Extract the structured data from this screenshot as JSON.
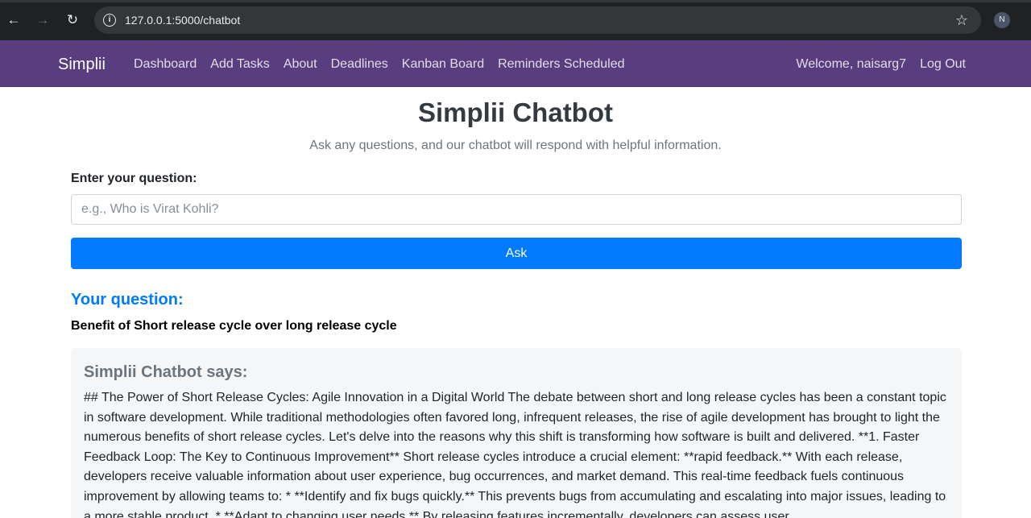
{
  "browser": {
    "url": "127.0.0.1:5000/chatbot",
    "profile_initial": "N",
    "icons": [
      "back-arrow-icon",
      "forward-arrow-icon",
      "reload-icon",
      "info-icon",
      "star-icon"
    ]
  },
  "navbar": {
    "brand": "Simplii",
    "links": [
      "Dashboard",
      "Add Tasks",
      "About",
      "Deadlines",
      "Kanban Board",
      "Reminders Scheduled"
    ],
    "welcome": "Welcome, naisarg7",
    "logout": "Log Out",
    "background_color": "#5a3d7f"
  },
  "main": {
    "title": "Simplii Chatbot",
    "subtitle": "Ask any questions, and our chatbot will respond with helpful information.",
    "question_label": "Enter your question:",
    "question_placeholder": "e.g., Who is Virat Kohli?",
    "question_value": "",
    "ask_label": "Ask",
    "your_question_heading": "Your question:",
    "question_text": "Benefit of Short release cycle over long release cycle",
    "response_heading": "Simplii Chatbot says:",
    "response_text": "## The Power of Short Release Cycles: Agile Innovation in a Digital World The debate between short and long release cycles has been a constant topic in software development. While traditional methodologies often favored long, infrequent releases, the rise of agile development has brought to light the numerous benefits of short release cycles. Let's delve into the reasons why this shift is transforming how software is built and delivered. **1. Faster Feedback Loop: The Key to Continuous Improvement** Short release cycles introduce a crucial element: **rapid feedback.** With each release, developers receive valuable information about user experience, bug occurrences, and market demand. This real-time feedback fuels continuous improvement by allowing teams to: * **Identify and fix bugs quickly.** This prevents bugs from accumulating and escalating into major issues, leading to a more stable product. * **Adapt to changing user needs.** By releasing features incrementally, developers can assess user",
    "accent_color": "#007bff"
  }
}
